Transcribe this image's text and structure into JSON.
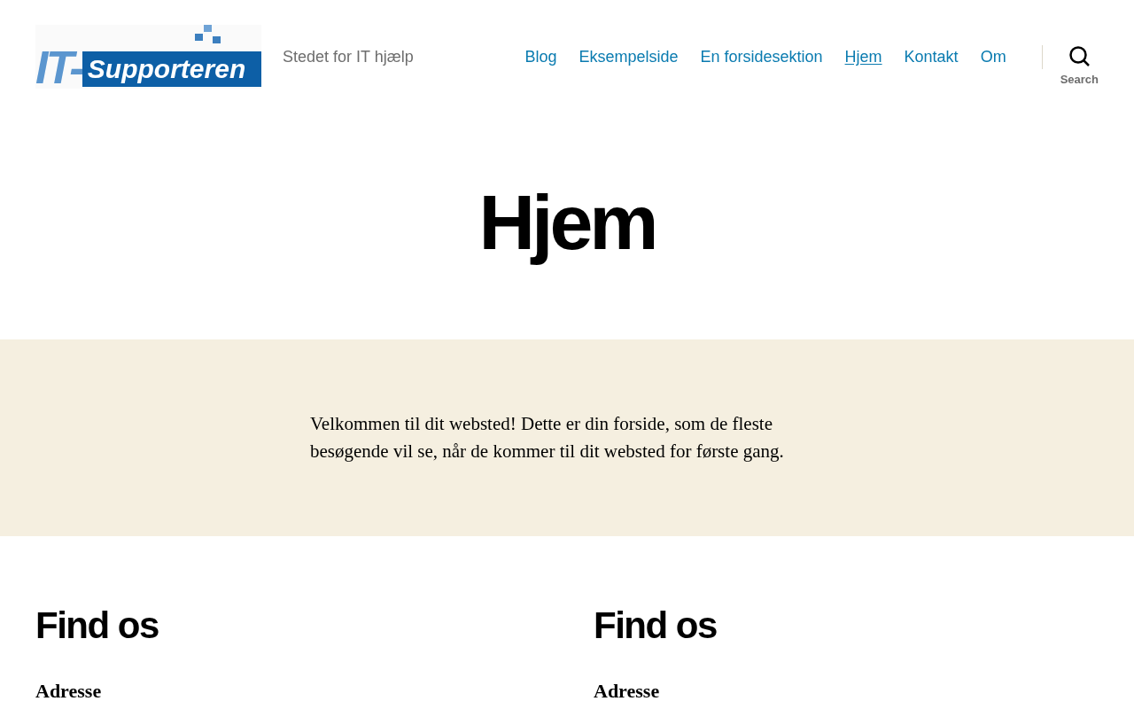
{
  "header": {
    "logo": {
      "mark": "IT-",
      "name": "Supporteren"
    },
    "tagline": "Stedet for IT hjælp",
    "nav": [
      {
        "label": "Blog",
        "selected": false
      },
      {
        "label": "Eksempelside",
        "selected": false
      },
      {
        "label": "En forsidesektion",
        "selected": false
      },
      {
        "label": "Hjem",
        "selected": true
      },
      {
        "label": "Kontakt",
        "selected": false
      },
      {
        "label": "Om",
        "selected": false
      }
    ],
    "search_label": "Search"
  },
  "page_title": "Hjem",
  "intro": "Velkommen til dit websted! Dette er din forside, som de fleste besøgende vil se, når de kommer til dit websted for første gang.",
  "columns": [
    {
      "heading": "Find os",
      "subheading": "Adresse"
    },
    {
      "heading": "Find os",
      "subheading": "Adresse"
    }
  ]
}
